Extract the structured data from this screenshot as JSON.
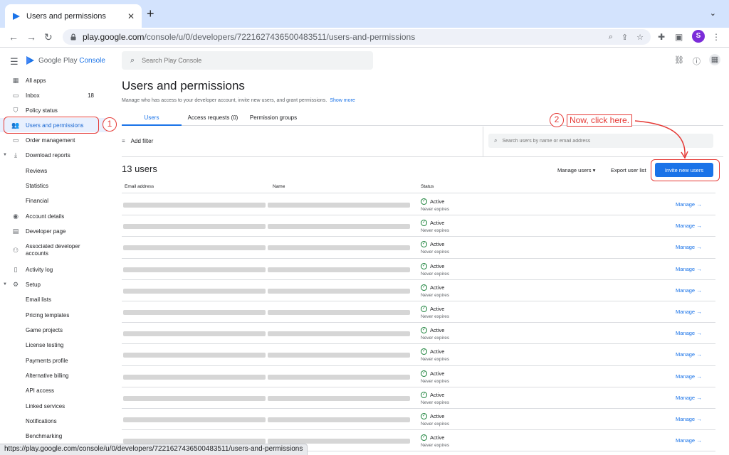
{
  "browser": {
    "tab_title": "Users and permissions",
    "url_host": "play.google.com",
    "url_path": "/console/u/0/developers/7221627436500483511/users-and-permissions",
    "profile_initial": "S",
    "status_url": "https://play.google.com/console/u/0/developers/7221627436500483511/users-and-permissions"
  },
  "header": {
    "brand_prefix": "Google Play",
    "brand_suffix": "Console",
    "search_placeholder": "Search Play Console"
  },
  "sidebar": {
    "items": [
      {
        "label": "All apps",
        "icon": "grid-icon"
      },
      {
        "label": "Inbox",
        "icon": "inbox-icon",
        "count": "18"
      },
      {
        "label": "Policy status",
        "icon": "shield-icon"
      },
      {
        "label": "Users and permissions",
        "icon": "users-icon",
        "active": true
      },
      {
        "label": "Order management",
        "icon": "card-icon"
      },
      {
        "label": "Download reports",
        "icon": "download-icon"
      },
      {
        "label": "Reviews"
      },
      {
        "label": "Statistics"
      },
      {
        "label": "Financial"
      },
      {
        "label": "Account details",
        "icon": "account-icon"
      },
      {
        "label": "Developer page",
        "icon": "page-icon"
      },
      {
        "label": "Associated developer accounts",
        "icon": "link-accounts-icon"
      },
      {
        "label": "Activity log",
        "icon": "log-icon"
      },
      {
        "label": "Setup",
        "icon": "gear-icon"
      },
      {
        "label": "Email lists"
      },
      {
        "label": "Pricing templates"
      },
      {
        "label": "Game projects"
      },
      {
        "label": "License testing"
      },
      {
        "label": "Payments profile"
      },
      {
        "label": "Alternative billing"
      },
      {
        "label": "API access"
      },
      {
        "label": "Linked services"
      },
      {
        "label": "Notifications"
      },
      {
        "label": "Benchmarking"
      }
    ]
  },
  "annotations": {
    "step1_number": "1",
    "step2_number": "2",
    "step2_text": "Now, click here."
  },
  "main": {
    "title": "Users and permissions",
    "description": "Manage who has access to your developer account, invite new users, and grant permissions.",
    "show_more": "Show more",
    "tabs": [
      {
        "label": "Users",
        "active": true
      },
      {
        "label": "Access requests (0)"
      },
      {
        "label": "Permission groups"
      }
    ],
    "add_filter": "Add filter",
    "user_search_placeholder": "Search users by name or email address",
    "count_title": "13 users",
    "manage_users": "Manage users",
    "export_user_list": "Export user list",
    "invite_button": "Invite new users",
    "table": {
      "columns": [
        "Email address",
        "Name",
        "Status"
      ],
      "rows": [
        {
          "status": "Active",
          "expiry": "Never expires",
          "action": "Manage"
        },
        {
          "status": "Active",
          "expiry": "Never expires",
          "action": "Manage"
        },
        {
          "status": "Active",
          "expiry": "Never expires",
          "action": "Manage"
        },
        {
          "status": "Active",
          "expiry": "Never expires",
          "action": "Manage"
        },
        {
          "status": "Active",
          "expiry": "Never expires",
          "action": "Manage"
        },
        {
          "status": "Active",
          "expiry": "Never expires",
          "action": "Manage"
        },
        {
          "status": "Active",
          "expiry": "Never expires",
          "action": "Manage"
        },
        {
          "status": "Active",
          "expiry": "Never expires",
          "action": "Manage"
        },
        {
          "status": "Active",
          "expiry": "Never expires",
          "action": "Manage"
        },
        {
          "status": "Active",
          "expiry": "Never expires",
          "action": "Manage"
        },
        {
          "status": "Active",
          "expiry": "Never expires",
          "action": "Manage"
        },
        {
          "status": "Active",
          "expiry": "Never expires",
          "action": "Manage"
        }
      ]
    }
  },
  "colors": {
    "accent": "#1a73e8",
    "annotation": "#e53935",
    "active_green": "#188038"
  }
}
